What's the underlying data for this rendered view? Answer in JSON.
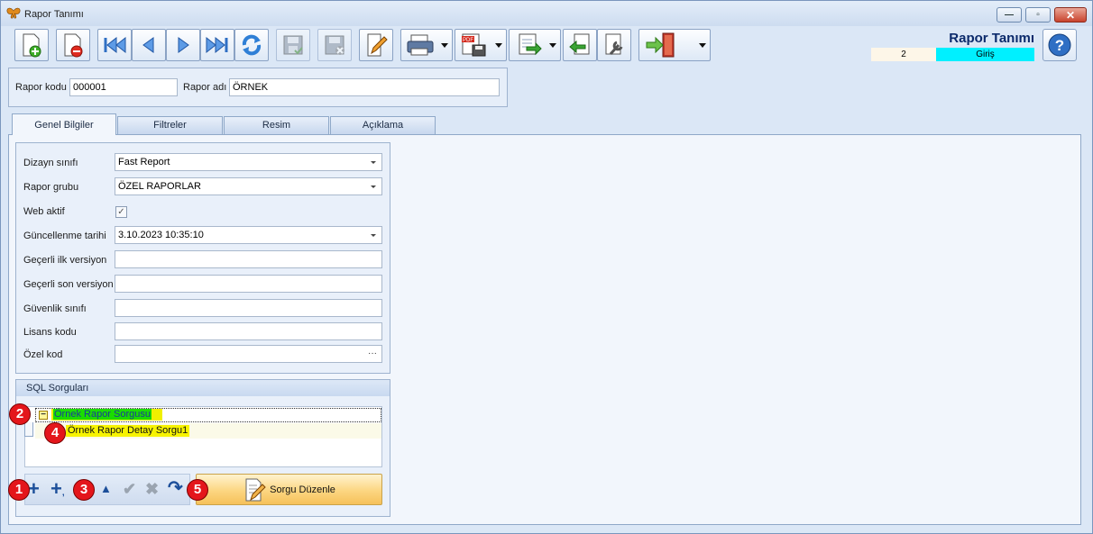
{
  "window": {
    "title": "Rapor Tanımı"
  },
  "header": {
    "title": "Rapor Tanımı",
    "record_no": "2",
    "mode": "Giriş"
  },
  "report": {
    "code_label": "Rapor kodu",
    "code_value": "000001",
    "name_label": "Rapor adı",
    "name_value": "ÖRNEK"
  },
  "tabs": [
    {
      "label": "Genel Bilgiler",
      "active": true
    },
    {
      "label": "Filtreler"
    },
    {
      "label": "Resim"
    },
    {
      "label": "Açıklama"
    }
  ],
  "form": {
    "design_class_label": "Dizayn sınıfı",
    "design_class_value": "Fast Report",
    "report_group_label": "Rapor grubu",
    "report_group_value": "ÖZEL RAPORLAR",
    "web_active_label": "Web aktif",
    "web_active_checked": true,
    "updated_label": "Güncellenme tarihi",
    "updated_value": "3.10.2023 10:35:10",
    "first_version_label": "Geçerli ilk versiyon",
    "first_version_value": "",
    "last_version_label": "Geçerli son versiyon",
    "last_version_value": "",
    "security_label": "Güvenlik sınıfı",
    "security_value": "",
    "license_label": "Lisans kodu",
    "license_value": "",
    "special_code_label": "Özel kod",
    "special_code_value": ""
  },
  "sql": {
    "header": "SQL Sorguları",
    "nodes": [
      "Örnek Rapor Sorgusu",
      "Örnek Rapor Detay Sorgu1"
    ],
    "edit_button": "Sorgu Düzenle"
  },
  "badges": [
    "1",
    "2",
    "3",
    "4",
    "5"
  ],
  "colors": {
    "mode_bg": "#00f0ff",
    "highlight_yellow": "#f0f000",
    "highlight_green": "#1bdc00",
    "badge_red": "#e4161b",
    "button_orange": "#fcd681"
  }
}
